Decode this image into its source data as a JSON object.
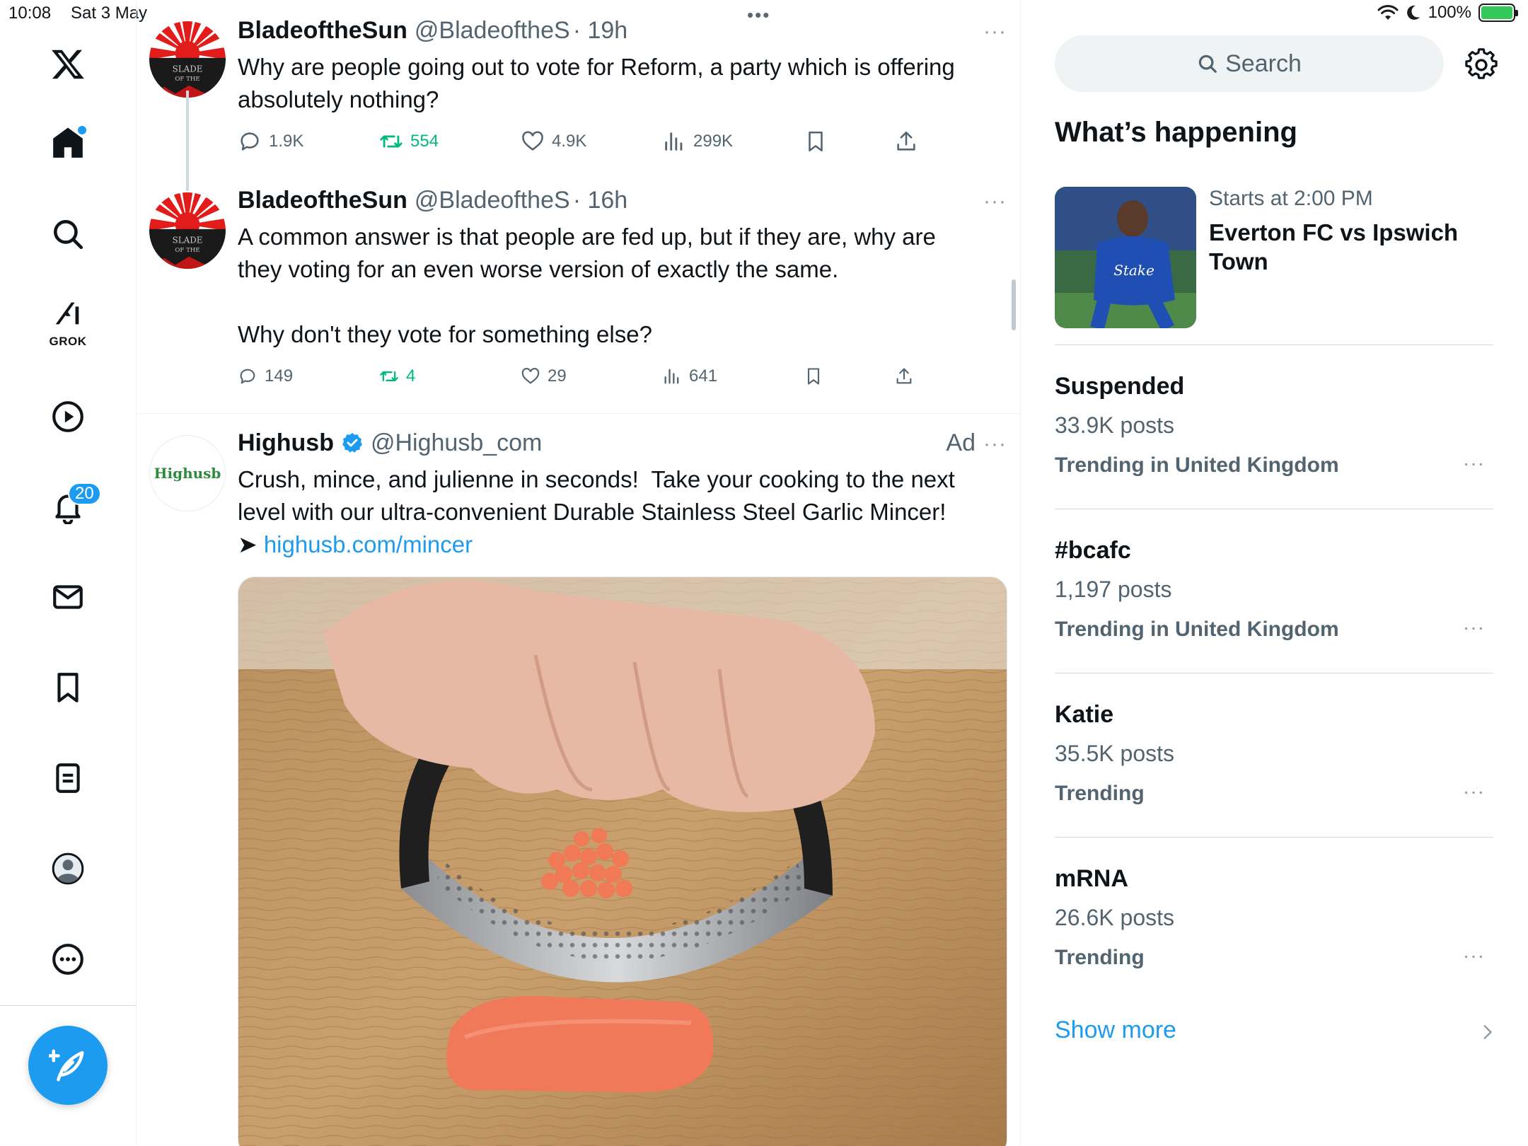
{
  "status_bar": {
    "time": "10:08",
    "date": "Sat 3 May",
    "dots": "•••",
    "battery": "100%"
  },
  "nav": {
    "grok_label": "GROK",
    "notification_count": "20",
    "icons": [
      "x-logo-icon",
      "home-icon",
      "search-icon",
      "grok-icon",
      "video-icon",
      "bell-icon",
      "mail-icon",
      "bookmark-icon",
      "lists-icon",
      "profile-icon",
      "more-icon",
      "compose-icon"
    ]
  },
  "timeline": {
    "tweets": [
      {
        "name": "BladeoftheSun",
        "handle": "@BladeoftheS",
        "time": "· 19h",
        "more": "···",
        "text": "Why are people going out to vote for Reform, a party which is offering absolutely nothing?",
        "replies": "1.9K",
        "retweets": "554",
        "likes": "4.9K",
        "views": "299K"
      },
      {
        "name": "BladeoftheSun",
        "handle": "@BladeoftheS",
        "time": "· 16h",
        "more": "···",
        "text": "A common answer is that people are fed up, but if they are, why are they voting for an even worse version of exactly the same.\n\nWhy don't they vote for something else?",
        "replies": "149",
        "retweets": "4",
        "likes": "29",
        "views": "641"
      }
    ],
    "ad": {
      "name": "Highusb",
      "handle": "@Highusb_com",
      "ad_label": "Ad",
      "more": "···",
      "avatar_text": "Highusb",
      "text": "Crush, mince, and julienne in seconds!  Take your cooking to the next level with our ultra-convenient Durable Stainless Steel Garlic Mincer!",
      "arrow": "➤ ",
      "link": "highusb.com/mincer"
    }
  },
  "sidebar": {
    "search_placeholder": "Search",
    "section_title": "What’s happening",
    "event": {
      "time": "Starts at 2:00 PM",
      "title": "Everton FC vs Ipswich Town"
    },
    "trends": [
      {
        "name": "Suspended",
        "count": "33.9K posts",
        "context": "Trending in United Kingdom",
        "more": "···"
      },
      {
        "name": "#bcafc",
        "count": "1,197 posts",
        "context": "Trending in United Kingdom",
        "more": "···"
      },
      {
        "name": "Katie",
        "count": "35.5K posts",
        "context": "Trending",
        "more": "···"
      },
      {
        "name": "mRNA",
        "count": "26.6K posts",
        "context": "Trending",
        "more": "···"
      }
    ],
    "show_more": "Show more"
  },
  "colors": {
    "accent": "#1d9bf0",
    "retweet_green": "#00ba7c",
    "muted_text": "#536471"
  }
}
